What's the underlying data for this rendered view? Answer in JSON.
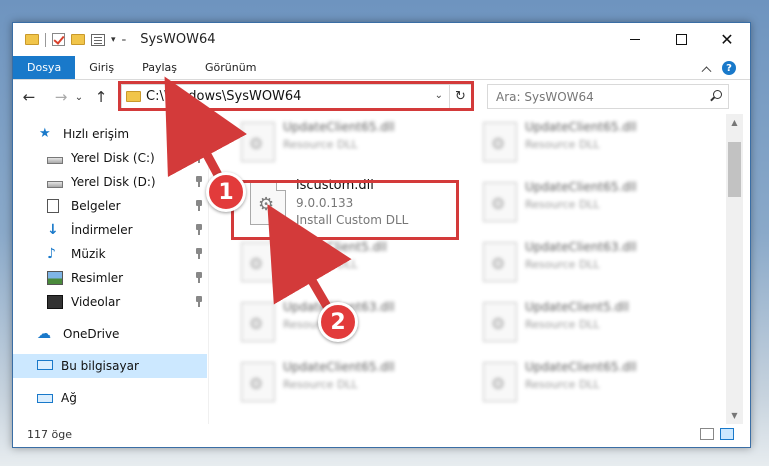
{
  "window": {
    "title": "SysWOW64",
    "minimize": "—",
    "maximize": "☐",
    "close": "✕"
  },
  "ribbon": {
    "tabs": [
      "Dosya",
      "Giriş",
      "Paylaş",
      "Görünüm"
    ],
    "help": "?"
  },
  "navigation": {
    "back": "←",
    "forward": "→",
    "recent": "⌄",
    "up": "↑",
    "address": "C:\\Windows\\SysWOW64",
    "address_dropdown": "⌄",
    "refresh": "↻",
    "search_placeholder": "Ara: SysWOW64"
  },
  "sidebar": {
    "items": [
      {
        "label": "Hızlı erişim",
        "icon": "star-icon",
        "pinned": false
      },
      {
        "label": "Yerel Disk (C:)",
        "icon": "drive-icon",
        "pinned": true
      },
      {
        "label": "Yerel Disk (D:)",
        "icon": "drive-icon",
        "pinned": true
      },
      {
        "label": "Belgeler",
        "icon": "documents-icon",
        "pinned": true
      },
      {
        "label": "İndirmeler",
        "icon": "downloads-icon",
        "pinned": true
      },
      {
        "label": "Müzik",
        "icon": "music-icon",
        "pinned": true
      },
      {
        "label": "Resimler",
        "icon": "pictures-icon",
        "pinned": true
      },
      {
        "label": "Videolar",
        "icon": "videos-icon",
        "pinned": true
      },
      {
        "label": "OneDrive",
        "icon": "onedrive-icon",
        "pinned": false
      },
      {
        "label": "Bu bilgisayar",
        "icon": "computer-icon",
        "pinned": false,
        "selected": true
      },
      {
        "label": "Ağ",
        "icon": "network-icon",
        "pinned": false
      }
    ]
  },
  "files": {
    "highlighted": {
      "name": "iscustom.dll",
      "version": "9.0.0.133",
      "description": "Install Custom DLL"
    },
    "blurred": [
      {
        "name": "UpdateClient65.dll",
        "description": "Resource DLL"
      },
      {
        "name": "UpdateClient65.dll",
        "description": "Resource DLL"
      },
      {
        "name": "UpdateClient65.dll",
        "description": "Resource DLL"
      },
      {
        "name": "UpdateClient5.dll",
        "description": "Resource DLL"
      },
      {
        "name": "UpdateClient63.dll",
        "description": "Resource DLL"
      },
      {
        "name": "UpdateClient63.dll",
        "description": "Resource DLL"
      },
      {
        "name": "UpdateClient5.dll",
        "description": "Resource DLL"
      },
      {
        "name": "UpdateClient65.dll",
        "description": "Resource DLL"
      },
      {
        "name": "UpdateClient65.dll",
        "description": "Resource DLL"
      }
    ]
  },
  "status": {
    "count": "117 öge"
  },
  "annotations": {
    "step1": "1",
    "step2": "2",
    "color": "#d33a3a"
  }
}
